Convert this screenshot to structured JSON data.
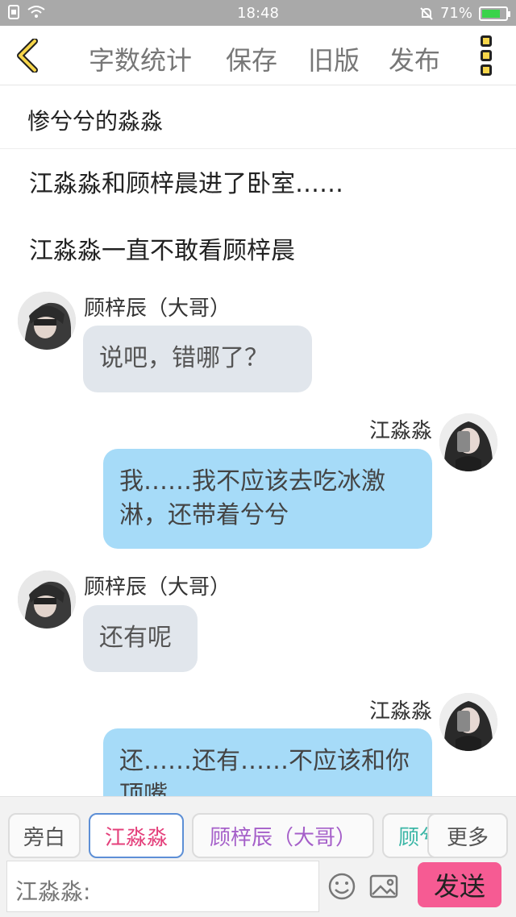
{
  "status_bar": {
    "time": "18:48",
    "battery": "71%"
  },
  "toolbar": {
    "word_count": "字数统计",
    "save": "保存",
    "old_version": "旧版",
    "publish": "发布"
  },
  "story_title": "惨兮兮的淼淼",
  "narrations": [
    "江淼淼和顾梓晨进了卧室……",
    "江淼淼一直不敢看顾梓晨"
  ],
  "messages": [
    {
      "speaker": "顾梓辰（大哥）",
      "text": "说吧，错哪了？"
    },
    {
      "speaker": "江淼淼",
      "text": "我……我不应该去吃冰激淋，还带着兮兮"
    },
    {
      "speaker": "顾梓辰（大哥）",
      "text": "还有呢"
    },
    {
      "speaker": "江淼淼",
      "text": "还……还有……不应该和你顶嘴"
    }
  ],
  "characters": [
    "旁白",
    "江淼淼",
    "顾梓辰（大哥）",
    "顾兮"
  ],
  "more_label": "更多",
  "input": {
    "placeholder": "江淼淼:"
  },
  "send_label": "发送",
  "colors": {
    "status_bar": "#a9a9a9",
    "left_bubble": "#e1e6ec",
    "right_bubble": "#a6dbf8",
    "send_button": "#f65b93",
    "chip_jiang": "#e4407b",
    "chip_gu": "#a55fc9",
    "chip_gu2": "#3bb6a6",
    "accent_yellow": "#f7d64a"
  }
}
